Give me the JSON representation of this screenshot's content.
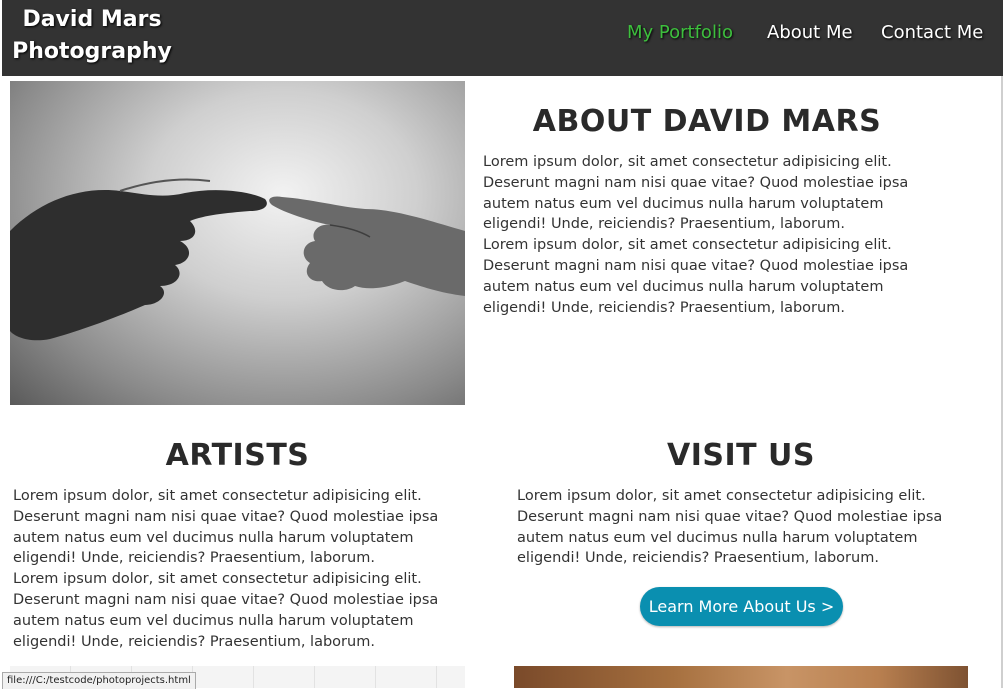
{
  "navbar": {
    "brand_line1": "David Mars",
    "brand_line2": "Photography",
    "links": [
      {
        "label": "My Portfolio",
        "active": true
      },
      {
        "label": "About Me",
        "active": false
      },
      {
        "label": "Contact Me",
        "active": false
      }
    ]
  },
  "about": {
    "title": "ABOUT DAVID MARS",
    "paragraphs": [
      "Lorem ipsum dolor, sit amet consectetur adipisicing elit. Deserunt magni nam nisi quae vitae? Quod molestiae ipsa autem natus eum vel ducimus nulla harum voluptatem eligendi! Unde, reiciendis? Praesentium, laborum.",
      "Lorem ipsum dolor, sit amet consectetur adipisicing elit. Deserunt magni nam nisi quae vitae? Quod molestiae ipsa autem natus eum vel ducimus nulla harum voluptatem eligendi! Unde, reiciendis? Praesentium, laborum."
    ]
  },
  "artists": {
    "title": "ARTISTS",
    "paragraphs": [
      "Lorem ipsum dolor, sit amet consectetur adipisicing elit. Deserunt magni nam nisi quae vitae? Quod molestiae ipsa autem natus eum vel ducimus nulla harum voluptatem eligendi! Unde, reiciendis? Praesentium, laborum.",
      "Lorem ipsum dolor, sit amet consectetur adipisicing elit. Deserunt magni nam nisi quae vitae? Quod molestiae ipsa autem natus eum vel ducimus nulla harum voluptatem eligendi! Unde, reiciendis? Praesentium, laborum."
    ]
  },
  "visit": {
    "title": "VISIT US",
    "paragraph": "Lorem ipsum dolor, sit amet consectetur adipisicing elit. Deserunt magni nam nisi quae vitae? Quod molestiae ipsa autem natus eum vel ducimus nulla harum voluptatem eligendi! Unde, reiciendis? Praesentium, laborum.",
    "button_label": "Learn More About Us >"
  },
  "status_bar": {
    "url": "file:///C:/testcode/photoprojects.html"
  },
  "colors": {
    "navbar_bg": "#333333",
    "active_link": "#3dbf3d",
    "button_bg": "#0a8fb0"
  }
}
